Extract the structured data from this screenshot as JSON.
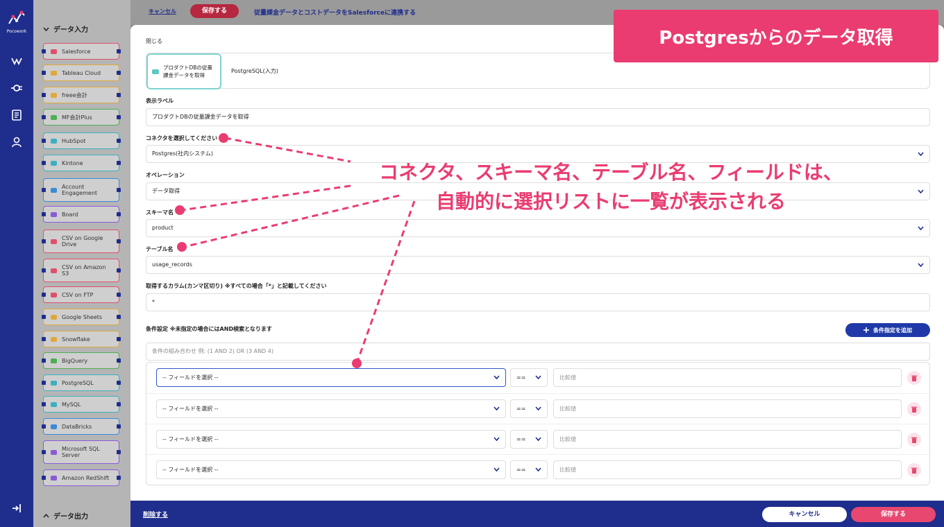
{
  "left_rail": {
    "logo_text": "Pocowork",
    "icons": [
      "workflow-icon",
      "connector-icon",
      "log-icon",
      "user-icon",
      "logout-icon"
    ]
  },
  "sidebar": {
    "input_section": "データ入力",
    "output_section": "データ出力",
    "connectors": [
      {
        "label": "Salesforce",
        "color": "#e0506a"
      },
      {
        "label": "Tableau Cloud",
        "color": "#e0a83a"
      },
      {
        "label": "freee会計",
        "color": "#e0a83a"
      },
      {
        "label": "MF会計Plus",
        "color": "#4caf50"
      },
      {
        "label": "HubSpot",
        "color": "#3ab0c0"
      },
      {
        "label": "Kintone",
        "color": "#3ab0c0"
      },
      {
        "label": "Account Engagement",
        "color": "#3a8ad8"
      },
      {
        "label": "Board",
        "color": "#8a5ad8"
      },
      {
        "label": "CSV on Google Drive",
        "color": "#e0506a"
      },
      {
        "label": "CSV on Amazon S3",
        "color": "#e0506a"
      },
      {
        "label": "CSV on FTP",
        "color": "#e0506a"
      },
      {
        "label": "Google Sheets",
        "color": "#e0a83a"
      },
      {
        "label": "Snowflake",
        "color": "#e0a83a"
      },
      {
        "label": "BigQuery",
        "color": "#4caf50"
      },
      {
        "label": "PostgreSQL",
        "color": "#3ab0c0"
      },
      {
        "label": "MySQL",
        "color": "#3ab0c0"
      },
      {
        "label": "DataBricks",
        "color": "#3a8ad8"
      },
      {
        "label": "Microsoft SQL Server",
        "color": "#8a5ad8"
      },
      {
        "label": "Amazon RedShift",
        "color": "#8a5ad8"
      }
    ]
  },
  "topbar": {
    "cancel": "キャンセル",
    "save": "保存する",
    "title": "従量課金データとコストデータをSalesforceに連携する"
  },
  "form": {
    "close": "閉じる",
    "node_chip": "プロダクトDBの従量課金データを取得",
    "node_type": "PostgreSQL(入力)",
    "display_label_title": "表示ラベル",
    "display_label_value": "プロダクトDBの従量課金データを取得",
    "connector_title": "コネクタを選択してください",
    "connector_value": "Postgres(社内システム)",
    "operation_title": "オペレーション",
    "operation_value": "データ取得",
    "schema_title": "スキーマ名",
    "schema_value": "product",
    "table_title": "テーブル名",
    "table_value": "usage_records",
    "columns_title": "取得するカラム(カンマ区切り) ※すべての場合「*」と記載してください",
    "columns_value": "*",
    "condition_title": "条件設定 ※未指定の場合にはAND検索となります",
    "add_condition": "条件指定を追加",
    "combo_placeholder": "条件の組み合わせ 例: (1 AND 2) OR (3 AND 4)",
    "conditions": [
      {
        "field": "-- フィールドを選択 --",
        "op": "==",
        "value_placeholder": "比較値"
      },
      {
        "field": "-- フィールドを選択 --",
        "op": "==",
        "value_placeholder": "比較値"
      },
      {
        "field": "-- フィールドを選択 --",
        "op": "==",
        "value_placeholder": "比較値"
      },
      {
        "field": "-- フィールドを選択 --",
        "op": "==",
        "value_placeholder": "比較値"
      }
    ]
  },
  "bottombar": {
    "delete": "削除する",
    "cancel": "キャンセル",
    "save": "保存する"
  },
  "annotation": {
    "banner": "Postgresからのデータ取得",
    "callout_line1": "コネクタ、スキーマ名、テーブル名、フィールドは、",
    "callout_line2": "自動的に選択リストに一覧が表示される",
    "accent": "#ea3c70"
  }
}
